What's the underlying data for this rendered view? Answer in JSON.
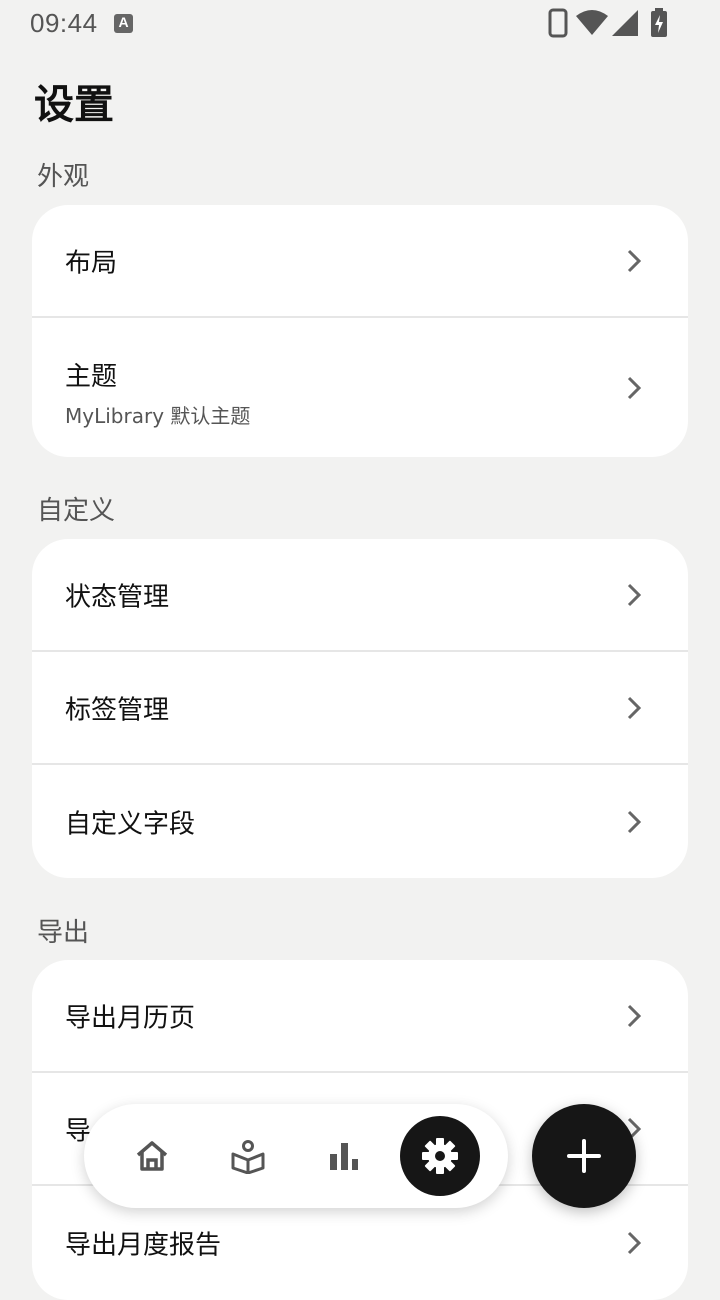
{
  "status_bar": {
    "time": "09:44",
    "notification_icon": "A"
  },
  "page": {
    "title": "设置"
  },
  "sections": [
    {
      "label": "外观",
      "items": [
        {
          "label": "布局"
        },
        {
          "label": "主题",
          "sublabel": "MyLibrary 默认主题"
        }
      ]
    },
    {
      "label": "自定义",
      "items": [
        {
          "label": "状态管理"
        },
        {
          "label": "标签管理"
        },
        {
          "label": "自定义字段"
        }
      ]
    },
    {
      "label": "导出",
      "items": [
        {
          "label": "导出月历页"
        },
        {
          "label": "导"
        },
        {
          "label": "导出月度报告"
        }
      ]
    }
  ],
  "bottom_nav": {
    "items": [
      {
        "icon": "home-icon"
      },
      {
        "icon": "reading-icon"
      },
      {
        "icon": "stats-icon"
      },
      {
        "icon": "settings-icon",
        "active": true
      }
    ],
    "fab_icon": "plus-icon"
  },
  "colors": {
    "background": "#f2f2f1",
    "card": "#ffffff",
    "accent": "#161616"
  }
}
